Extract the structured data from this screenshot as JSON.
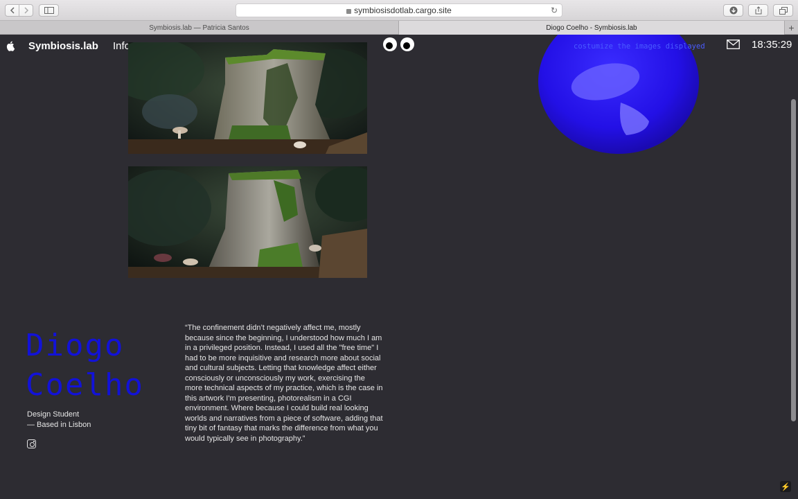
{
  "browser": {
    "url": "symbiosisdotlab.cargo.site",
    "tabs": [
      {
        "label": "Symbiosis.lab — Patricia Santos",
        "active": false
      },
      {
        "label": "Diogo Coelho - Symbiosis.lab",
        "active": true
      }
    ],
    "icons": {
      "back": "chevron-left-icon",
      "forward": "chevron-right-icon",
      "sidebar": "sidebar-icon",
      "reload": "reload-icon",
      "downloads": "download-icon",
      "share": "share-icon",
      "tabs_overview": "tabs-icon",
      "new_tab": "+"
    }
  },
  "header": {
    "site_name": "Symbiosis.lab",
    "nav_info": "Info",
    "customize_link": "costumize the images displayed",
    "clock": "18:35:29",
    "icons": {
      "logo": "apple-logo-icon",
      "mail": "mail-icon",
      "eyes": "googly-eyes-icon"
    }
  },
  "author": {
    "name_line1": "Diogo",
    "name_line2": "Coelho",
    "role_line1": "Design Student",
    "role_line2": "— Based in Lisbon",
    "social_icon": "instagram-icon"
  },
  "quote": "“The confinement didn’t negatively affect me, mostly because since the beginning, I understood how much I am in a privileged position. Instead, I used all the \"free time\" I had to be more inquisitive and research more about social and cultural subjects. Letting that knowledge affect either consciously or unconsciously my work, exercising the more technical aspects of my practice, which is the case in this artwork I'm presenting, photorealism in a CGI environment. Where because I could build real looking worlds and narratives from a piece of software, adding that tiny bit of fantasy that marks the difference from what you would typically see in photography.”",
  "images": [
    {
      "name": "tree-stump-render-1"
    },
    {
      "name": "tree-stump-render-2"
    }
  ],
  "colors": {
    "background": "#2d2c32",
    "accent_blue": "#1212d8",
    "link_blue": "#4a5cff",
    "blob_blue": "#2a12e8"
  },
  "edit_icon": "lightning-icon"
}
